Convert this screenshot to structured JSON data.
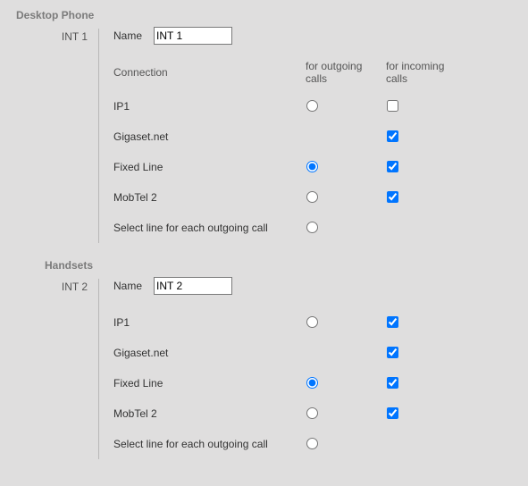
{
  "sections": {
    "desktop_phone": {
      "title": "Desktop Phone",
      "int_label": "INT 1",
      "name_label": "Name",
      "name_value": "INT 1",
      "headers": {
        "connection": "Connection",
        "outgoing": "for outgoing calls",
        "incoming": "for incoming calls"
      },
      "rows": {
        "ip1": {
          "label": "IP1",
          "outgoing_checked": false,
          "incoming_checked": false,
          "incoming_visible": true
        },
        "gigaset": {
          "label": "Gigaset.net",
          "incoming_checked": true
        },
        "fixedline": {
          "label": "Fixed Line",
          "outgoing_checked": true,
          "incoming_checked": true
        },
        "mobtel2": {
          "label": "MobTel 2",
          "outgoing_checked": false,
          "incoming_checked": true
        },
        "select": {
          "label": "Select line for each outgoing call",
          "outgoing_checked": false
        }
      }
    },
    "handsets": {
      "title": "Handsets",
      "int_label": "INT 2",
      "name_label": "Name",
      "name_value": "INT 2",
      "rows": {
        "ip1": {
          "label": "IP1",
          "outgoing_checked": false,
          "incoming_checked": true
        },
        "gigaset": {
          "label": "Gigaset.net",
          "incoming_checked": true
        },
        "fixedline": {
          "label": "Fixed Line",
          "outgoing_checked": true,
          "incoming_checked": true
        },
        "mobtel2": {
          "label": "MobTel 2",
          "outgoing_checked": false,
          "incoming_checked": true
        },
        "select": {
          "label": "Select line for each outgoing call",
          "outgoing_checked": false
        }
      }
    }
  }
}
